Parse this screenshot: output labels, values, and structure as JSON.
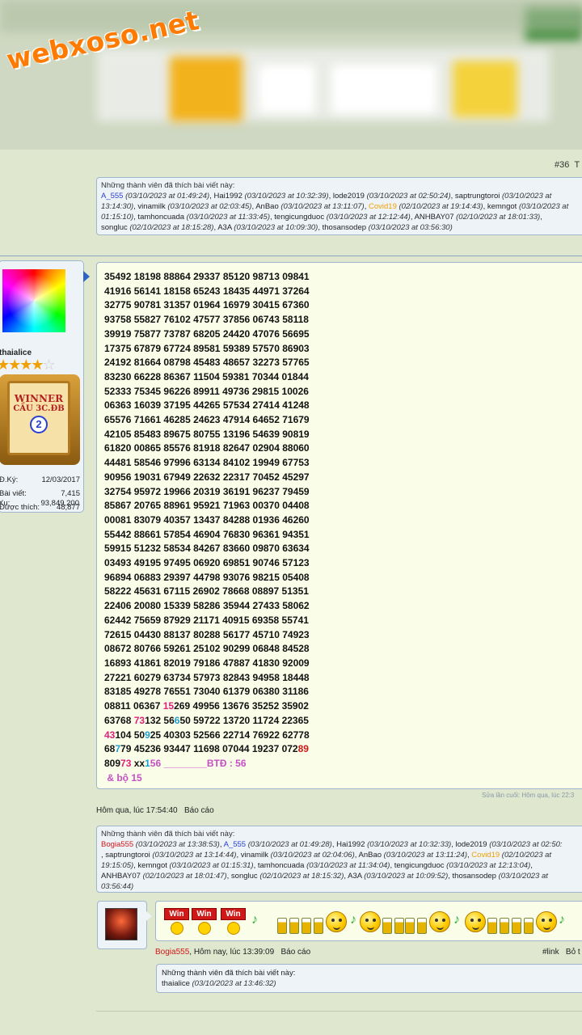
{
  "site_logo": "webxoso.net",
  "post_number": "#36",
  "post_number_tail": "T",
  "likes_top": {
    "header": "Những thành viên đã thích bài viết này:",
    "lines": [
      [
        {
          "t": "A_555",
          "c": "blue"
        },
        {
          "t": " (03/10/2023 at 01:49:24)",
          "i": true
        },
        {
          "t": ", Hai1992 "
        },
        {
          "t": "(03/10/2023 at 10:32:39)",
          "i": true
        },
        {
          "t": ", lode2019 "
        },
        {
          "t": "(03/10/2023 at 02:50:24)",
          "i": true
        },
        {
          "t": ", saptrungtoroi "
        },
        {
          "t": "(03/10/2023 at",
          "i": true
        }
      ],
      [
        {
          "t": "13:14:30)",
          "i": true
        },
        {
          "t": ", vinamilk "
        },
        {
          "t": "(03/10/2023 at 02:03:45)",
          "i": true
        },
        {
          "t": ", AnBao "
        },
        {
          "t": "(03/10/2023 at 13:11:07)",
          "i": true
        },
        {
          "t": ", "
        },
        {
          "t": "Covid19",
          "c": "orange"
        },
        {
          "t": " (02/10/2023 at 19:14:43)",
          "i": true
        },
        {
          "t": ", kemngot "
        },
        {
          "t": "(03/10/2023 at",
          "i": true
        }
      ],
      [
        {
          "t": "01:15:10)",
          "i": true
        },
        {
          "t": ", tamhoncuada "
        },
        {
          "t": "(03/10/2023 at 11:33:45)",
          "i": true
        },
        {
          "t": ", tengicungduoc "
        },
        {
          "t": "(03/10/2023 at 12:12:44)",
          "i": true
        },
        {
          "t": ", ANHBAY07 "
        },
        {
          "t": "(02/10/2023 at 18:01:33)",
          "i": true
        },
        {
          "t": ","
        }
      ],
      [
        {
          "t": "songluc "
        },
        {
          "t": "(02/10/2023 at 18:15:28)",
          "i": true
        },
        {
          "t": ", A3A "
        },
        {
          "t": "(03/10/2023 at 10:09:30)",
          "i": true
        },
        {
          "t": ", thosansodep "
        },
        {
          "t": "(03/10/2023 at 03:56:30)",
          "i": true
        }
      ]
    ]
  },
  "user": {
    "name": "thaialice",
    "trophy_line1": "WINNER",
    "trophy_line2": "CẦU 3C.ĐB",
    "trophy_rank": "2",
    "stats": [
      {
        "label": "Đ.Ký:",
        "value": "12/03/2017"
      },
      {
        "label": "Bài viết:",
        "value": "7,415"
      },
      {
        "label": "Được thích:",
        "value": "48,877"
      },
      {
        "label": "Xu:",
        "value": "93,849,200"
      }
    ]
  },
  "post_lines": [
    [
      {
        "t": "35492 18198 88864 29337 85120 98713 09841"
      }
    ],
    [
      {
        "t": "41916 56141 18158 65243 18435 44971 37264"
      }
    ],
    [
      {
        "t": "32775 90781 31357 01964 16979 30415 67360"
      }
    ],
    [
      {
        "t": "93758 55827 76102 47577 37856 06743 58118"
      }
    ],
    [
      {
        "t": "39919 75877 73787 68205 24420 47076 56695"
      }
    ],
    [
      {
        "t": "17375 67879 67724 89581 59389 57570 86903"
      }
    ],
    [
      {
        "t": "24192 81664 08798 45483 48657 32273 57765"
      }
    ],
    [
      {
        "t": "83230 66228 86367 11504 59381 70344 01844"
      }
    ],
    [
      {
        "t": "52333 75345 96226 89911 49736 29815 10026"
      }
    ],
    [
      {
        "t": "06363 16039 37195 44265 57534 27414 41248"
      }
    ],
    [
      {
        "t": "65576 71661 46285 24623 47914 64652 71679"
      }
    ],
    [
      {
        "t": "42105 85483 89675 80755 13196 54639 90819"
      }
    ],
    [
      {
        "t": "61820 00865 85576 81918 82647 02904 88060"
      }
    ],
    [
      {
        "t": "44481 58546 97996 63134 84102 19949 67753"
      }
    ],
    [
      {
        "t": "90956 19031 67949 22632 22317 70452 45297"
      }
    ],
    [
      {
        "t": "32754 95972 19966 20319 36191 96237 79459"
      }
    ],
    [
      {
        "t": "85867 20765 88961 95921 71963 00370 04408"
      }
    ],
    [
      {
        "t": "00081 83079 40357 13437 84288 01936 46260"
      }
    ],
    [
      {
        "t": "55442 88661 57854 46904 76830 96361 94351"
      }
    ],
    [
      {
        "t": "59915 51232 58534 84267 83660 09870 63634"
      }
    ],
    [
      {
        "t": "03493 49195 97495 06920 69851 90746 57123"
      }
    ],
    [
      {
        "t": "96894 06883 29397 44798 93076 98215 05408"
      }
    ],
    [
      {
        "t": "58222 45631 67115 26902 78668 08897 51351"
      }
    ],
    [
      {
        "t": "22406 20080 15339 58286 35944 27433 58062"
      }
    ],
    [
      {
        "t": "62442 75659 87929 21171 40915 69358 55741"
      }
    ],
    [
      {
        "t": "72615 04430 88137 80288 56177 45710 74923"
      }
    ],
    [
      {
        "t": "08672 80766 59261 25102 90299 06848 84528"
      }
    ],
    [
      {
        "t": "16893 41861 82019 79186 47887 41830 92009"
      }
    ],
    [
      {
        "t": "27221 60279 63734 57973 82843 94958 18448"
      }
    ],
    [
      {
        "t": "83185 49278 76551 73040 61379 06380 31186"
      }
    ],
    [
      {
        "t": "08811 06367 "
      },
      {
        "t": "15",
        "c": "pk"
      },
      {
        "t": "269 49956 13676 35252 35902"
      }
    ],
    [
      {
        "t": "63768 "
      },
      {
        "t": "73",
        "c": "pk"
      },
      {
        "t": "132 56"
      },
      {
        "t": "6",
        "c": "cy"
      },
      {
        "t": "50 59722 13720 11724 22365"
      }
    ],
    [
      {
        "t": "43",
        "c": "pk"
      },
      {
        "t": "104 50"
      },
      {
        "t": "9",
        "c": "cy"
      },
      {
        "t": "25 40303 52566 22714 76922 62778"
      }
    ],
    [
      {
        "t": "68"
      },
      {
        "t": "7",
        "c": "cy"
      },
      {
        "t": "79 45236 93447 11698 07044 19237 072"
      },
      {
        "t": "89",
        "c": "rd"
      }
    ],
    [
      {
        "t": "809"
      },
      {
        "t": "73",
        "c": "pk"
      },
      {
        "t": " xx"
      },
      {
        "t": "1",
        "c": "cy"
      },
      {
        "t": "56",
        "c": "pp"
      },
      {
        "t": " ________BTĐ : 56",
        "c": "pp"
      }
    ],
    [
      {
        "t": " & bộ 15",
        "c": "pp"
      }
    ]
  ],
  "edit_note": "Sửa lần cuối: Hôm qua, lúc 22:3",
  "post_meta": {
    "time": "Hôm qua, lúc 17:54:40",
    "report": "Báo cáo"
  },
  "likes_mid": {
    "header": "Những thành viên đã thích bài viết này:",
    "lines": [
      [
        {
          "t": "Bogia555",
          "c": "red"
        },
        {
          "t": " (03/10/2023 at 13:38:53)",
          "i": true
        },
        {
          "t": ", "
        },
        {
          "t": "A_555",
          "c": "blue"
        },
        {
          "t": " (03/10/2023 at 01:49:28)",
          "i": true
        },
        {
          "t": ", Hai1992 "
        },
        {
          "t": "(03/10/2023 at 10:32:33)",
          "i": true
        },
        {
          "t": ", lode2019 "
        },
        {
          "t": "(03/10/2023 at 02:50:",
          "i": true
        }
      ],
      [
        {
          "t": ", saptrungtoroi "
        },
        {
          "t": "(03/10/2023 at 13:14:44)",
          "i": true
        },
        {
          "t": ", vinamilk "
        },
        {
          "t": "(03/10/2023 at 02:04:06)",
          "i": true
        },
        {
          "t": ", AnBao "
        },
        {
          "t": "(03/10/2023 at 13:11:24)",
          "i": true
        },
        {
          "t": ", "
        },
        {
          "t": "Covid19",
          "c": "orange"
        },
        {
          "t": " (02/10/2023 at",
          "i": true
        }
      ],
      [
        {
          "t": "19:15:05)",
          "i": true
        },
        {
          "t": ", kemngot "
        },
        {
          "t": "(03/10/2023 at 01:15:31)",
          "i": true
        },
        {
          "t": ", tamhoncuada "
        },
        {
          "t": "(03/10/2023 at 11:34:04)",
          "i": true
        },
        {
          "t": ", tengicungduoc "
        },
        {
          "t": "(03/10/2023 at 12:13:04)",
          "i": true
        },
        {
          "t": ","
        }
      ],
      [
        {
          "t": "ANHBAY07 "
        },
        {
          "t": "(02/10/2023 at 18:01:47)",
          "i": true
        },
        {
          "t": ", songluc "
        },
        {
          "t": "(02/10/2023 at 18:15:32)",
          "i": true
        },
        {
          "t": ", A3A "
        },
        {
          "t": "(03/10/2023 at 10:09:52)",
          "i": true
        },
        {
          "t": ", thosansodep "
        },
        {
          "t": "(03/10/2023 at",
          "i": true
        }
      ],
      [
        {
          "t": "03:56:44)",
          "i": true
        }
      ]
    ]
  },
  "reply": {
    "badge_label": "Win",
    "author": "Bogia555",
    "time": ", Hôm nay, lúc 13:39:09",
    "report": "Báo cáo",
    "link": "#link",
    "link_tail": "Bỏ t"
  },
  "thanks": {
    "header": "Những thành viên đã thích bài viết này:",
    "user": "thaialice",
    "time": "(03/10/2023 at 13:46:32)"
  },
  "icons": [
    "win-badge-icon",
    "smiley-icon",
    "beer-mugs-icon",
    "music-note-icon",
    "star-empty-icon"
  ]
}
